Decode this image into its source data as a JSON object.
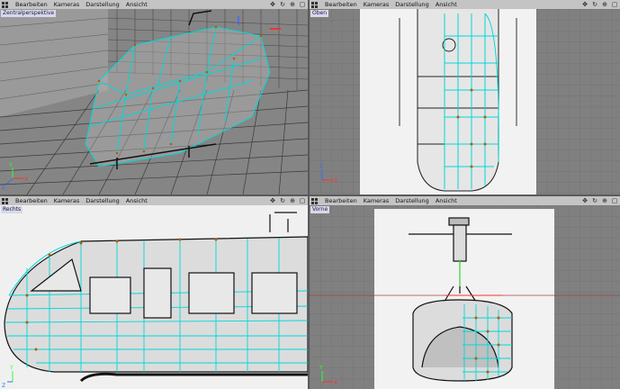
{
  "menu": {
    "edit": "Bearbeiten",
    "cameras": "Kameras",
    "display": "Darstellung",
    "view": "Ansicht"
  },
  "viewports": {
    "persp": {
      "label": "Zentralperspektive"
    },
    "top": {
      "label": "Oben"
    },
    "right": {
      "label": "Rechts"
    },
    "front": {
      "label": "Vorne"
    }
  },
  "axes": {
    "x": "X",
    "y": "Y",
    "z": "Z"
  },
  "colors": {
    "menu_bg": "#c4c4c4",
    "grid": "#6c6c6c",
    "wire": "#00d8d8",
    "points": "#b85a00",
    "axis_x": "#ff3030",
    "axis_y": "#30ff30",
    "axis_z": "#3070ff",
    "reference_bg": "#f2f2f2"
  },
  "icons": [
    "move-icon",
    "rotate-icon",
    "zoom-icon",
    "maximize-icon"
  ]
}
